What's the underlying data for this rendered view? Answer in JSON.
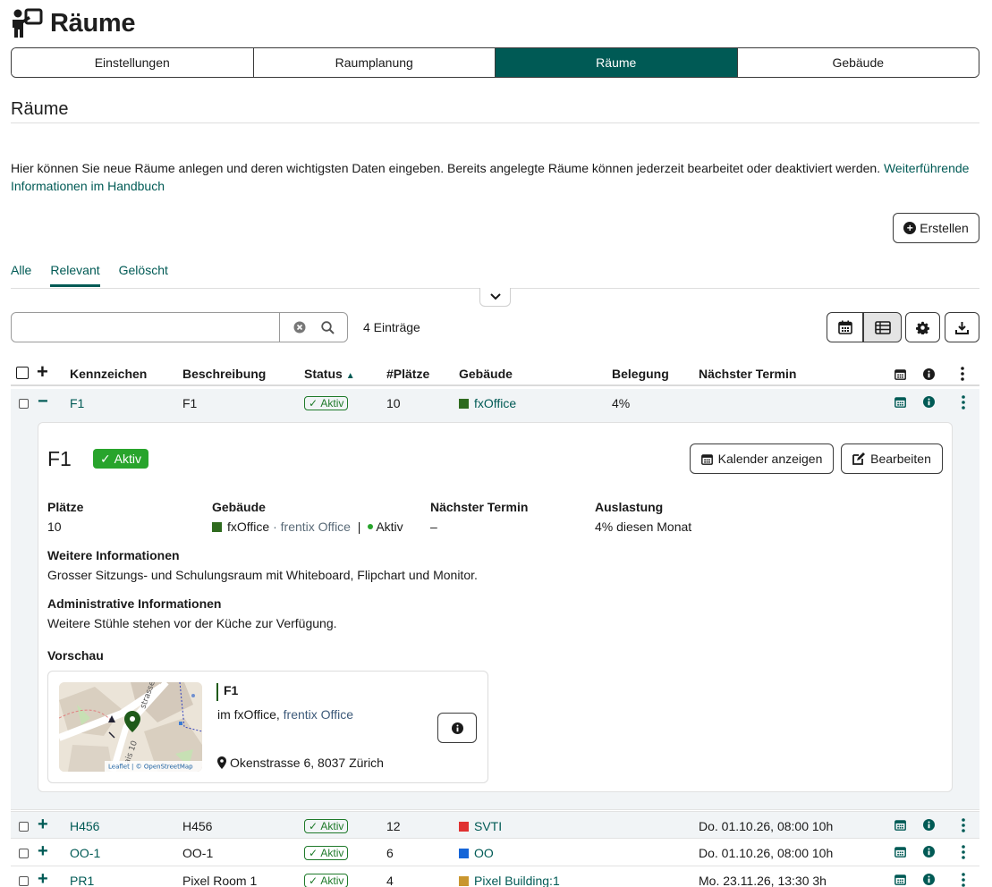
{
  "header": {
    "title": "Räume"
  },
  "tabs": [
    {
      "label": "Einstellungen",
      "active": false
    },
    {
      "label": "Raumplanung",
      "active": false
    },
    {
      "label": "Räume",
      "active": true
    },
    {
      "label": "Gebäude",
      "active": false
    }
  ],
  "section": {
    "title": "Räume",
    "intro": "Hier können Sie neue Räume anlegen und deren wichtigsten Daten eingeben. Bereits angelegte Räume können jederzeit bearbeitet oder deaktiviert werden.",
    "intro_link": "Weiterführende Informationen im Handbuch",
    "create_label": "Erstellen"
  },
  "filter_tabs": [
    {
      "label": "Alle",
      "active": false
    },
    {
      "label": "Relevant",
      "active": true
    },
    {
      "label": "Gelöscht",
      "active": false
    }
  ],
  "search": {
    "value": "",
    "placeholder": "",
    "count_label": "4 Einträge"
  },
  "table": {
    "columns": {
      "kennzeichen": "Kennzeichen",
      "beschreibung": "Beschreibung",
      "status": "Status",
      "plaetze": "#Plätze",
      "gebaeude": "Gebäude",
      "belegung": "Belegung",
      "termin": "Nächster Termin"
    },
    "rows": [
      {
        "kennzeichen": "F1",
        "beschreibung": "F1",
        "status": "Aktiv",
        "plaetze": "10",
        "gebaeude": "fxOffice",
        "color": "#2f6b1f",
        "belegung": "4%",
        "termin": "",
        "expanded": true
      },
      {
        "kennzeichen": "H456",
        "beschreibung": "H456",
        "status": "Aktiv",
        "plaetze": "12",
        "gebaeude": "SVTI",
        "color": "#e03131",
        "belegung": "",
        "termin": "Do. 01.10.26, 08:00 10h",
        "expanded": false
      },
      {
        "kennzeichen": "OO-1",
        "beschreibung": "OO-1",
        "status": "Aktiv",
        "plaetze": "6",
        "gebaeude": "OO",
        "color": "#1565d8",
        "belegung": "",
        "termin": "Do. 01.10.26, 08:00 10h",
        "expanded": false
      },
      {
        "kennzeichen": "PR1",
        "beschreibung": "Pixel Room 1",
        "status": "Aktiv",
        "plaetze": "4",
        "gebaeude": "Pixel Building:1",
        "color": "#c9962e",
        "belegung": "",
        "termin": "Mo. 23.11.26, 13:30 3h",
        "expanded": false
      }
    ]
  },
  "detail": {
    "title": "F1",
    "status": "Aktiv",
    "calendar_button": "Kalender anzeigen",
    "edit_button": "Bearbeiten",
    "plaetze_label": "Plätze",
    "plaetze_value": "10",
    "gebaeude_label": "Gebäude",
    "gebaeude_name": "fxOffice",
    "gebaeude_sub": "· frentix Office",
    "gebaeude_sep": "|",
    "gebaeude_status": "Aktiv",
    "termin_label": "Nächster Termin",
    "termin_value": "–",
    "auslastung_label": "Auslastung",
    "auslastung_value": "4% diesen Monat",
    "info_label": "Weitere Informationen",
    "info_value": "Grosser Sitzungs- und Schulungsraum mit Whiteboard, Flipchart und Monitor.",
    "admin_label": "Administrative Informationen",
    "admin_value": "Weitere Stühle stehen vor der Küche zur Verfügung.",
    "preview_label": "Vorschau",
    "preview": {
      "name": "F1",
      "in_text": "im fxOffice,",
      "in_link": "frentix Office",
      "address": "Okenstrasse 6, 8037 Zürich",
      "map_attribution": "Leaflet | © OpenStreetMap",
      "map_street1": "strasse",
      "map_street2": "ais 10"
    }
  },
  "colors": {
    "accent": "#005a55",
    "active_badge": "#28a42c"
  }
}
